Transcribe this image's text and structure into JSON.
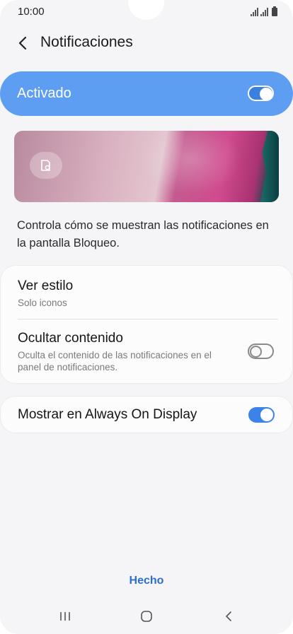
{
  "status_bar": {
    "time": "10:00"
  },
  "header": {
    "title": "Notificaciones"
  },
  "master_switch": {
    "label": "Activado",
    "enabled": true
  },
  "description": "Controla cómo se muestran las notificaciones en la pantalla Bloqueo.",
  "settings": {
    "view_style": {
      "title": "Ver estilo",
      "value": "Solo iconos"
    },
    "hide_content": {
      "title": "Ocultar contenido",
      "summary": "Oculta el contenido de las notificaciones en el panel de notificaciones.",
      "enabled": false
    },
    "always_on_display": {
      "title": "Mostrar en Always On Display",
      "enabled": true
    }
  },
  "footer": {
    "done_label": "Hecho"
  },
  "colors": {
    "accent": "#3b83e8",
    "master_bg": "#5d9ef2",
    "done_text": "#2c6ec9"
  }
}
